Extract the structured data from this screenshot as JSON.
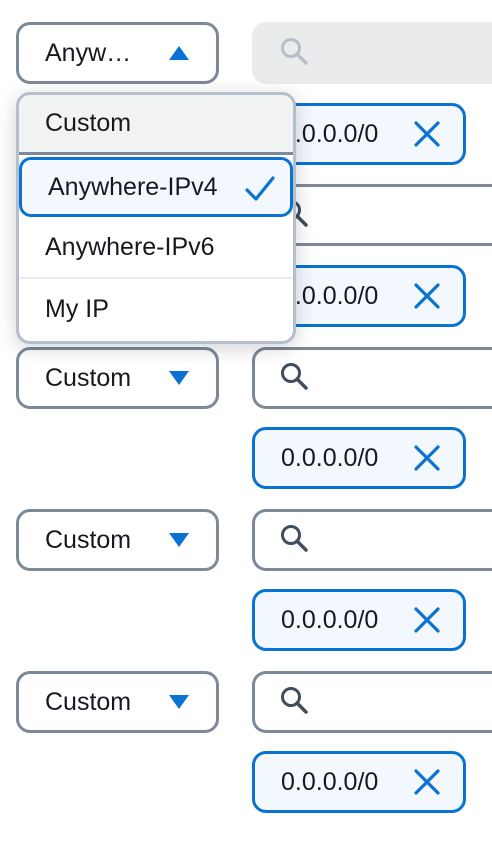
{
  "colors": {
    "accent": "#0972d3",
    "border": "#7d8998",
    "text": "#16191f"
  },
  "open_select": {
    "label": "Anyw…",
    "caret": "caret-up-icon"
  },
  "dropdown": {
    "options": [
      {
        "label": "Custom",
        "state": "hovered"
      },
      {
        "label": "Anywhere-IPv4",
        "state": "selected",
        "check": "checkmark-icon"
      },
      {
        "label": "Anywhere-IPv6",
        "state": "normal"
      },
      {
        "label": "My IP",
        "state": "normal"
      }
    ]
  },
  "rules": [
    {
      "source_type": "Anywhere-IPv4",
      "search_placeholder": "",
      "token": "0.0.0.0/0"
    },
    {
      "source_type": "Custom",
      "search_placeholder": "",
      "token": "0.0.0.0/0"
    },
    {
      "source_type": "Custom",
      "search_placeholder": "",
      "token": "0.0.0.0/0"
    },
    {
      "source_type": "Custom",
      "search_placeholder": "",
      "token": "0.0.0.0/0"
    },
    {
      "source_type": "Custom",
      "search_placeholder": "",
      "token": "0.0.0.0/0"
    }
  ]
}
